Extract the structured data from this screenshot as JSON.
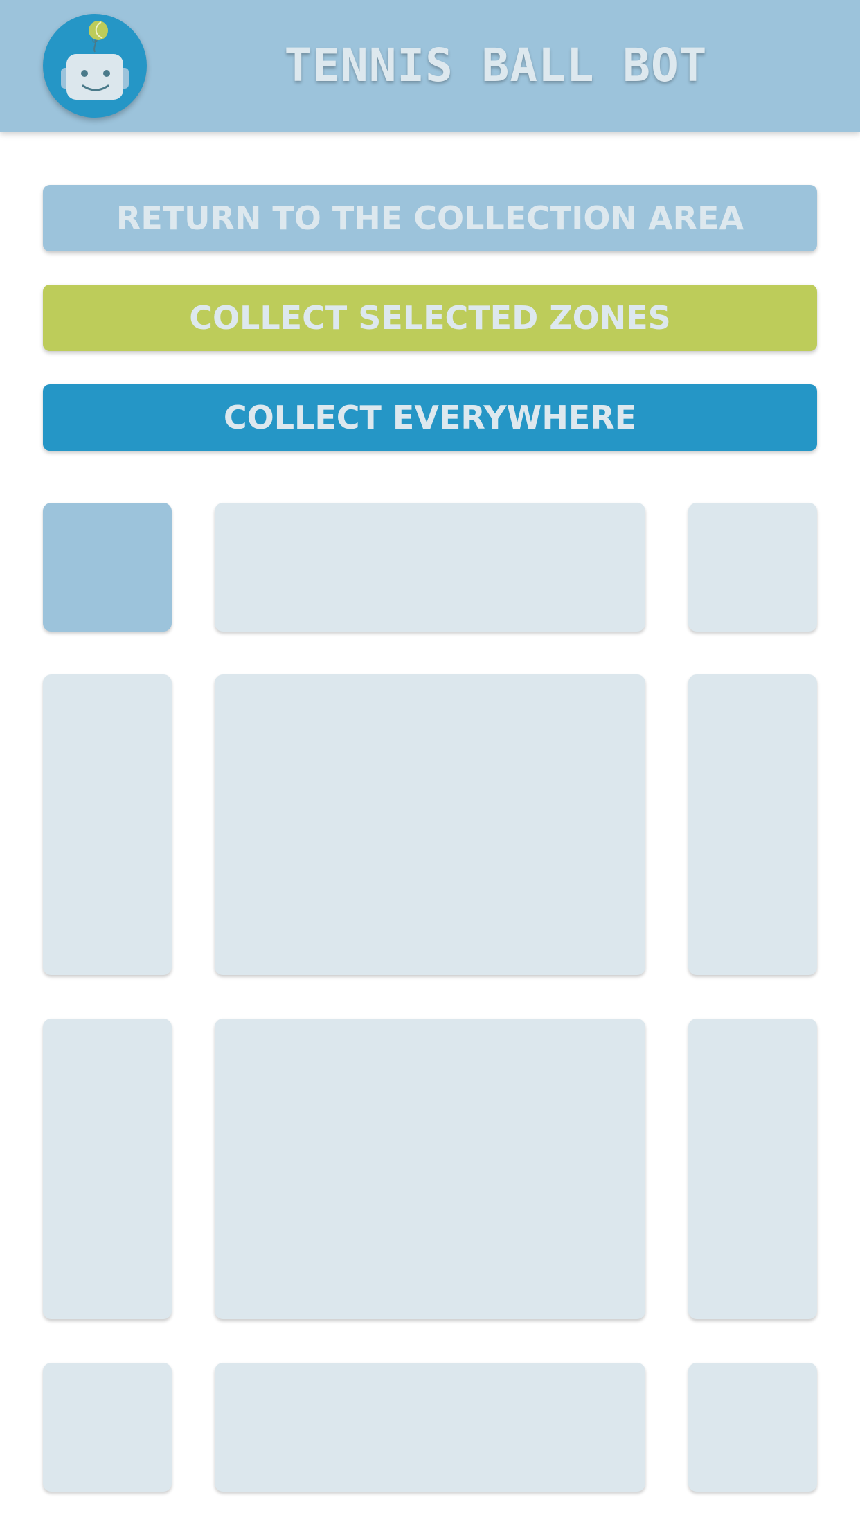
{
  "header": {
    "title": "TENNIS BALL BOT",
    "logo_icon": "robot-icon"
  },
  "actions": {
    "return_label": "RETURN TO THE COLLECTION AREA",
    "collect_selected_label": "COLLECT SELECTED ZONES",
    "collect_everywhere_label": "COLLECT EVERYWHERE"
  },
  "colors": {
    "header": "#9cc3db",
    "return_button": "#9cc3db",
    "collect_selected_button": "#bdcc5a",
    "collect_everywhere_button": "#2596c6",
    "zone_default": "#dce7ed",
    "zone_selected": "#9cc3db",
    "button_text": "#dde8ee"
  },
  "zones": {
    "rows": [
      [
        {
          "selected": true
        },
        {
          "selected": false
        },
        {
          "selected": false
        }
      ],
      [
        {
          "selected": false
        },
        {
          "selected": false
        },
        {
          "selected": false
        }
      ],
      [
        {
          "selected": false
        },
        {
          "selected": false
        },
        {
          "selected": false
        }
      ],
      [
        {
          "selected": false
        },
        {
          "selected": false
        },
        {
          "selected": false
        }
      ]
    ]
  }
}
